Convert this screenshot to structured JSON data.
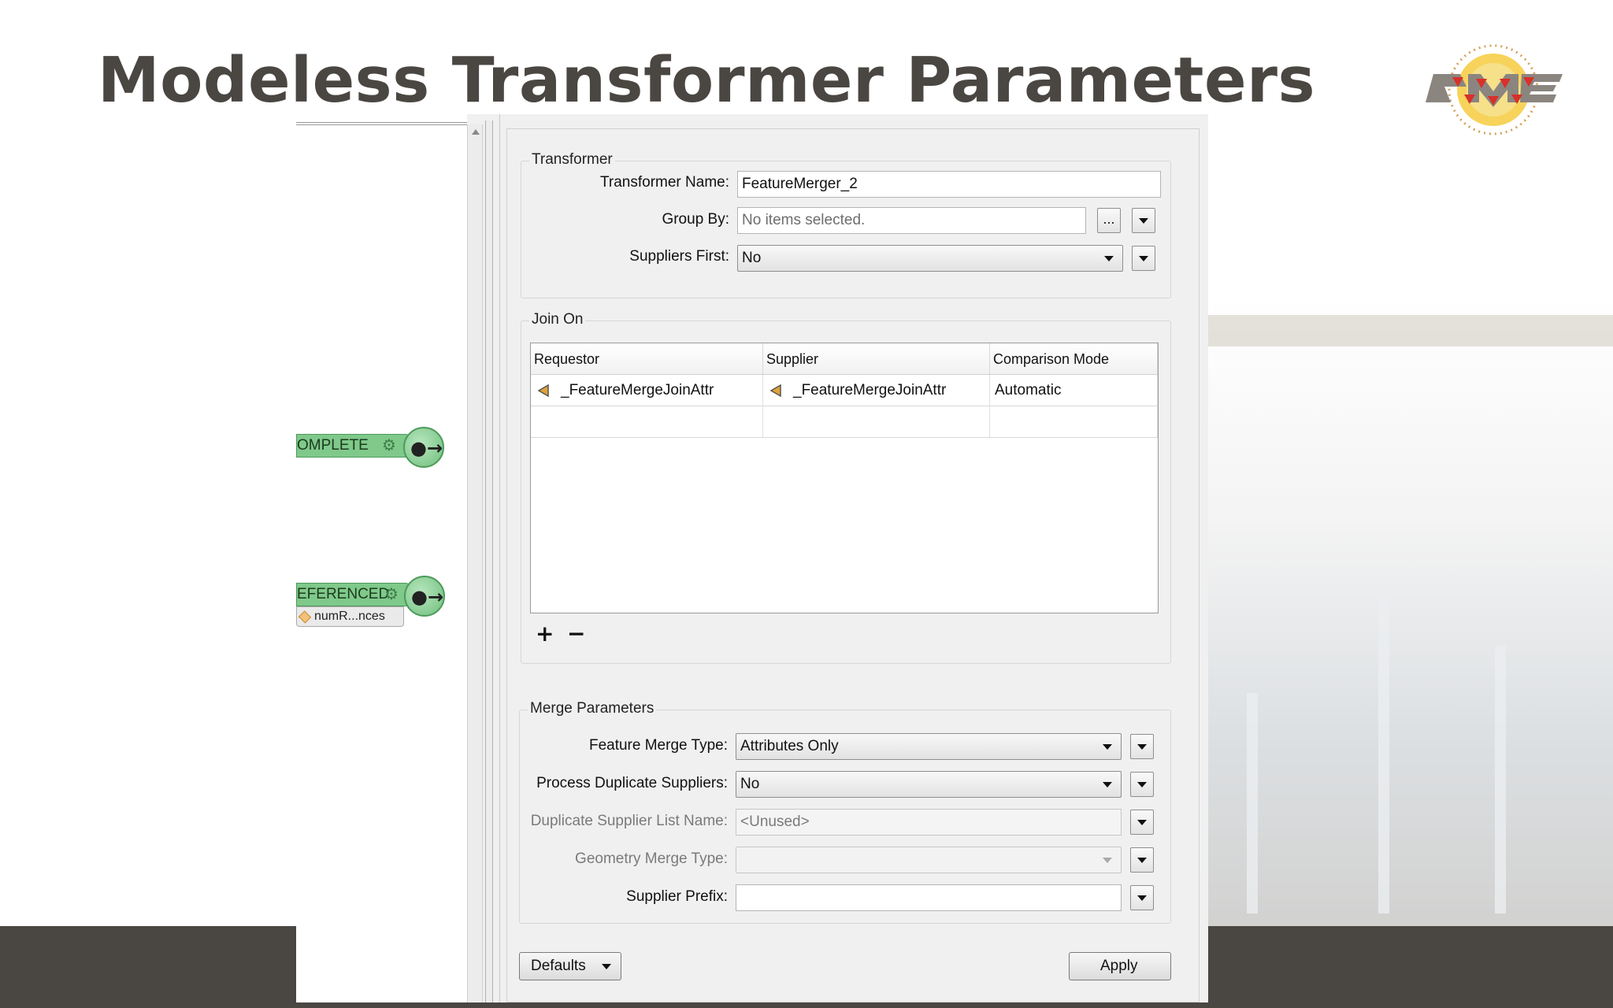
{
  "slide": {
    "title": "Modeless Transformer Parameters"
  },
  "colors": {
    "title": "#4a4642",
    "bottom_band": "#4a4642",
    "port_green": "#7fc98a"
  },
  "canvas": {
    "ports": [
      {
        "label": "OMPLETE",
        "icon": "gear-icon"
      },
      {
        "label": "EFERENCED",
        "icon": "gear-icon"
      }
    ],
    "attribute_chip": "numR...nces"
  },
  "transformer_group": {
    "legend": "Transformer",
    "name_label": "Transformer Name:",
    "name_value": "FeatureMerger_2",
    "group_by_label": "Group By:",
    "group_by_placeholder": "No items selected.",
    "group_by_button": "...",
    "suppliers_first_label": "Suppliers First:",
    "suppliers_first_value": "No"
  },
  "join_on": {
    "legend": "Join On",
    "columns": [
      "Requestor",
      "Supplier",
      "Comparison Mode"
    ],
    "rows": [
      {
        "requestor": "_FeatureMergeJoinAttr",
        "supplier": "_FeatureMergeJoinAttr",
        "mode": "Automatic"
      }
    ],
    "add_label": "+",
    "remove_label": "−"
  },
  "merge": {
    "legend": "Merge Parameters",
    "feature_merge_type_label": "Feature Merge Type:",
    "feature_merge_type_value": "Attributes Only",
    "process_duplicates_label": "Process Duplicate Suppliers:",
    "process_duplicates_value": "No",
    "dup_list_label": "Duplicate Supplier List Name:",
    "dup_list_value": "<Unused>",
    "geometry_merge_label": "Geometry Merge Type:",
    "geometry_merge_value": "",
    "supplier_prefix_label": "Supplier Prefix:",
    "supplier_prefix_value": ""
  },
  "footer": {
    "defaults_label": "Defaults",
    "apply_label": "Apply"
  }
}
